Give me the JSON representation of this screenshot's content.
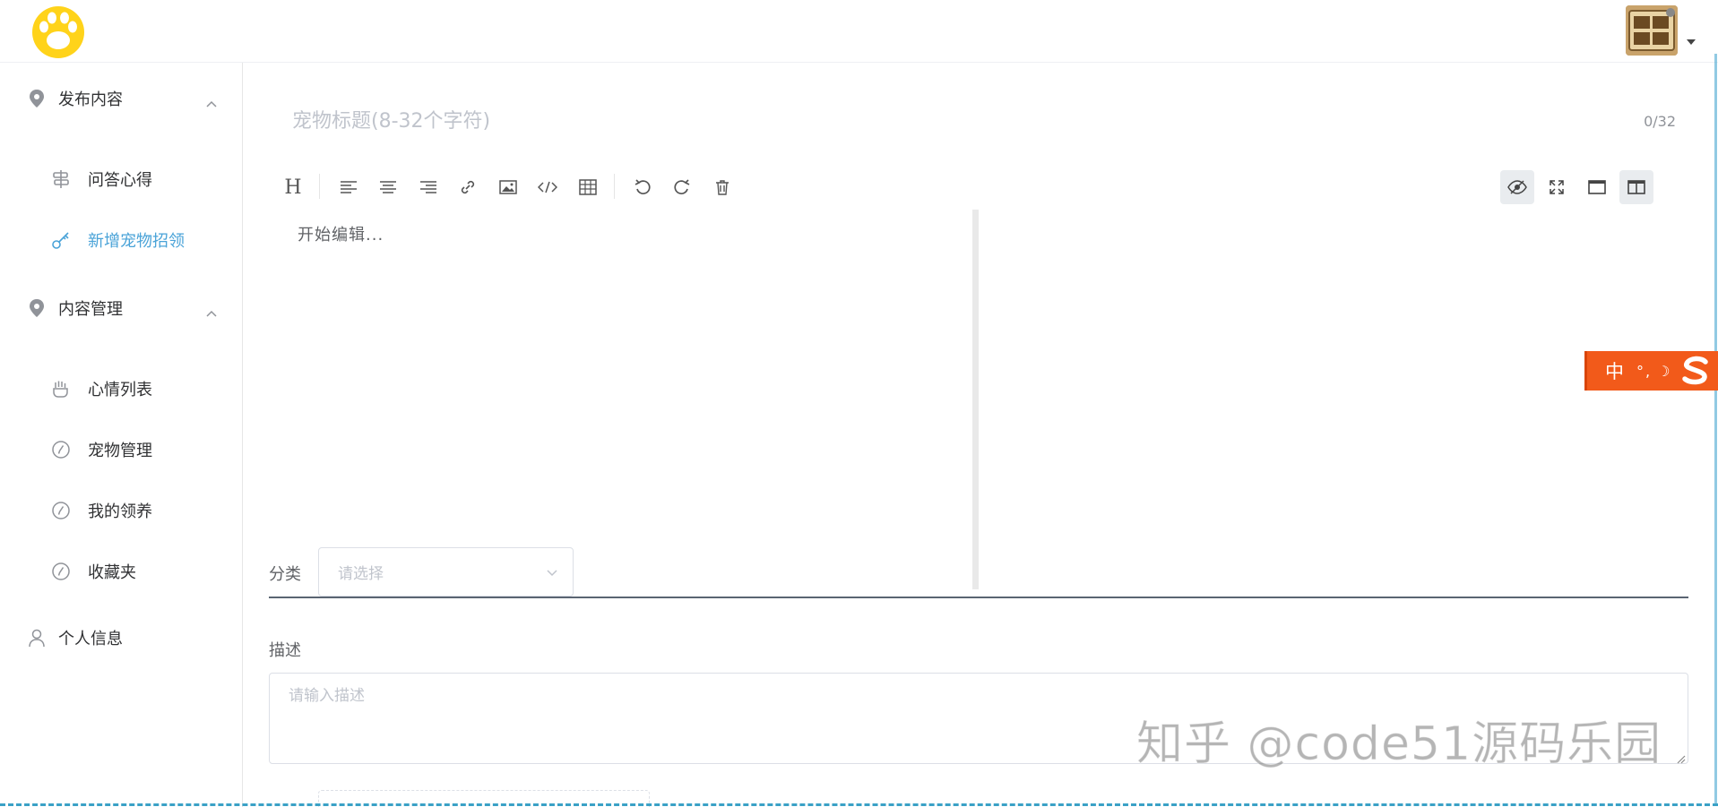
{
  "header": {
    "logo_icon": "paw-icon",
    "avatar_icon": "user-avatar-image"
  },
  "sidebar": {
    "groups": [
      {
        "title": "发布内容",
        "icon": "location-pin-icon",
        "items": [
          {
            "label": "问答心得",
            "icon": "signpost-icon",
            "active": false
          },
          {
            "label": "新增宠物招领",
            "icon": "key-icon",
            "active": true
          }
        ]
      },
      {
        "title": "内容管理",
        "icon": "location-pin-icon",
        "items": [
          {
            "label": "心情列表",
            "icon": "hand-icon",
            "active": false
          },
          {
            "label": "宠物管理",
            "icon": "compass-icon",
            "active": false
          },
          {
            "label": "我的领养",
            "icon": "compass-icon",
            "active": false
          },
          {
            "label": "收藏夹",
            "icon": "compass-icon",
            "active": false
          }
        ]
      }
    ],
    "profile": {
      "label": "个人信息",
      "icon": "user-icon"
    }
  },
  "form": {
    "title_placeholder": "宠物标题(8-32个字符)",
    "title_count": "0/32",
    "editor_placeholder": "开始编辑...",
    "category_label": "分类",
    "category_placeholder": "请选择",
    "description_label": "描述",
    "description_placeholder": "请输入描述"
  },
  "toolbar": {
    "left_buttons": [
      "heading-icon",
      "align-left-icon",
      "align-center-icon",
      "align-right-icon",
      "link-icon",
      "image-icon",
      "code-icon",
      "table-icon",
      "undo-icon",
      "redo-icon",
      "trash-icon"
    ],
    "right_buttons": [
      "preview-toggle-icon",
      "fullscreen-icon",
      "page-fullscreen-icon",
      "split-view-icon"
    ]
  },
  "ime": {
    "mode": "中",
    "punct": "°,",
    "moon": "☽"
  },
  "watermark": "知乎 @code51源码乐园",
  "colors": {
    "accent": "#4aa3d8",
    "logo_yellow": "#ffd31a",
    "ime_orange": "#f25a1a"
  }
}
